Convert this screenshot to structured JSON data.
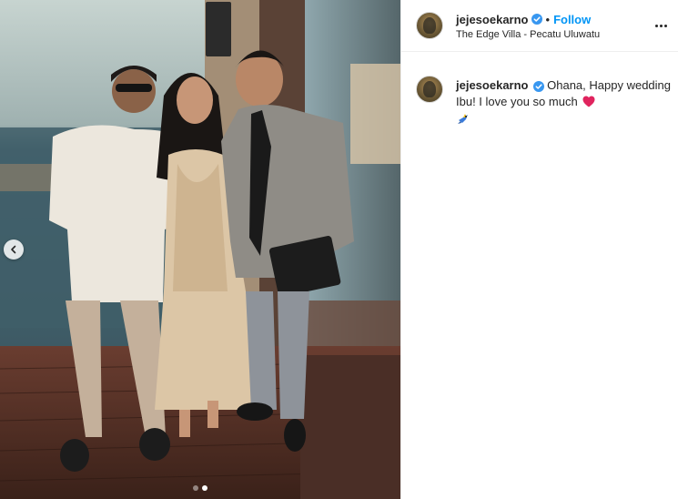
{
  "post": {
    "username": "jejesoekarno",
    "follow_label": "Follow",
    "separator": "•",
    "location": "The Edge Villa - Pecatu Uluwatu",
    "caption_text": "Ohana, Happy wedding Ibu! I love you so much",
    "icons": {
      "verified": "verified-badge-icon",
      "heart": "red-heart-icon",
      "emoji": "bird-emoji-icon",
      "more": "more-options-icon",
      "prev": "chevron-left-icon"
    },
    "colors": {
      "accent": "#0095f6",
      "heart": "#e0245e",
      "text": "#262626"
    }
  },
  "carousel": {
    "slide_count": 2,
    "active_index": 1
  }
}
